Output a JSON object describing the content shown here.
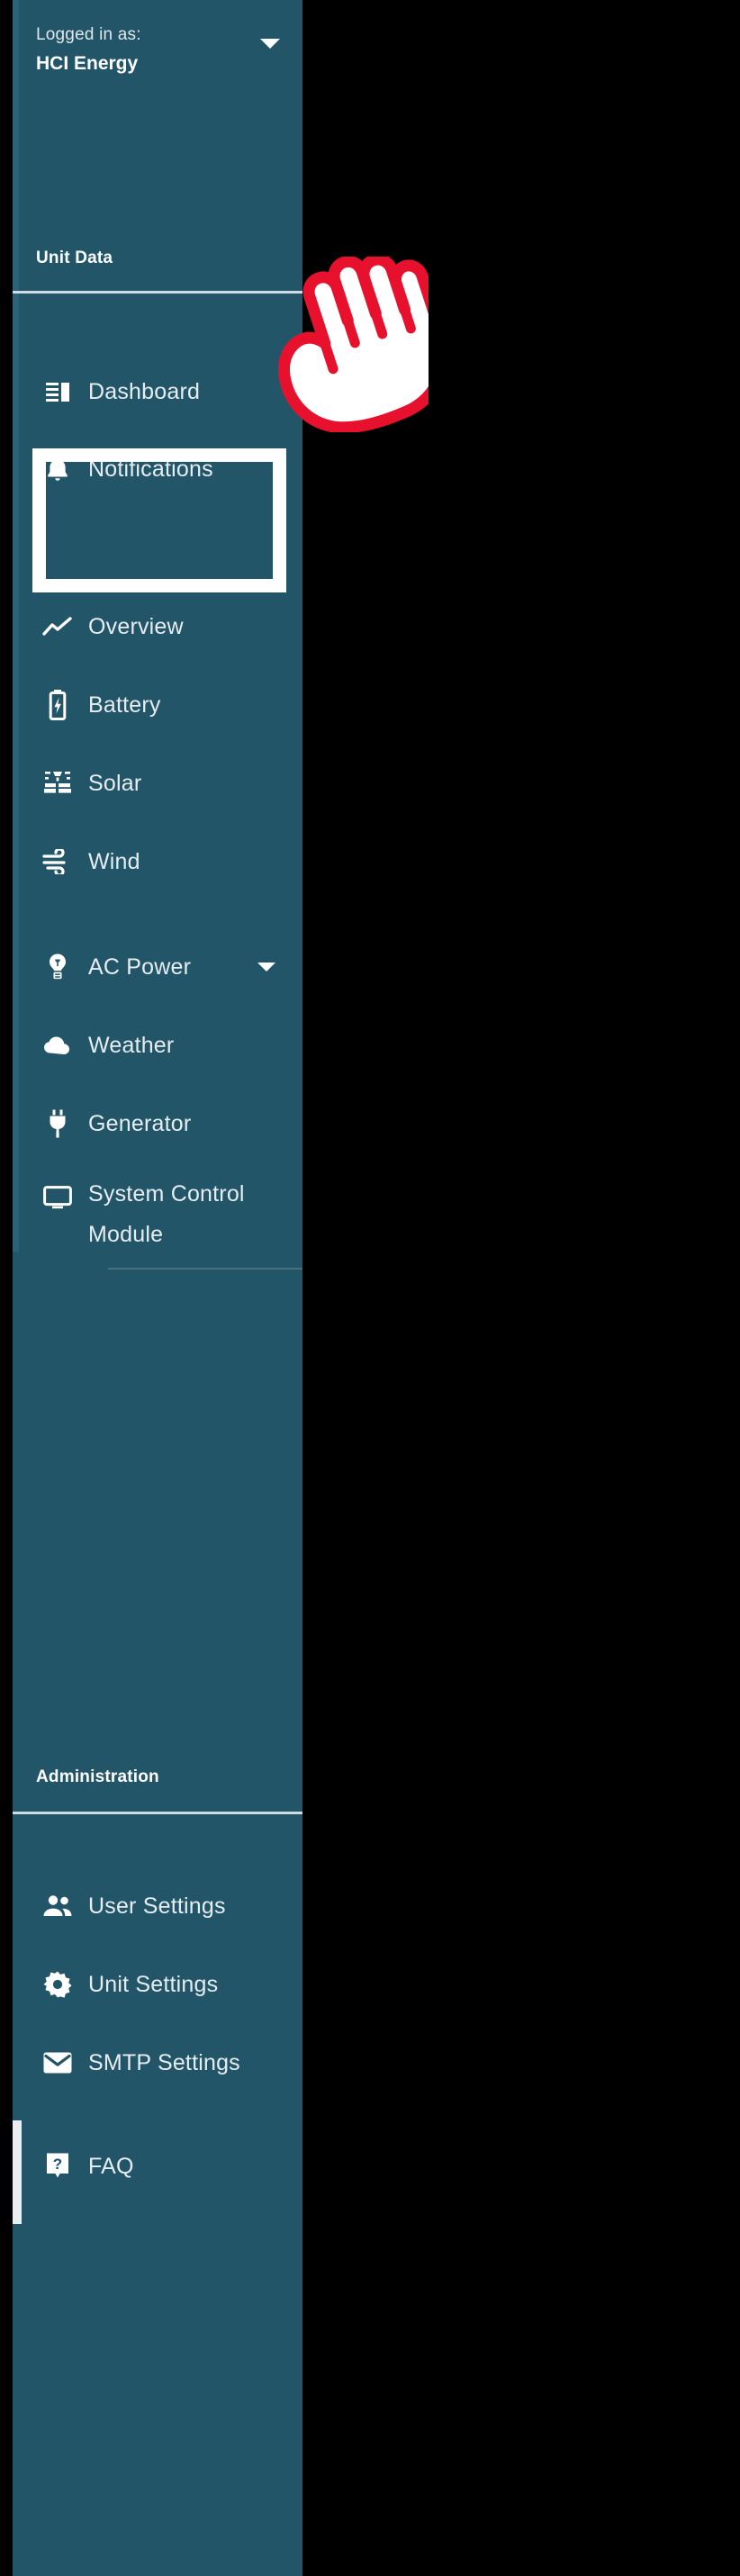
{
  "app": {
    "background_color": "#000000",
    "sidebar_color": "#235568",
    "text_color": "#e6edf1",
    "highlight_color": "#ffffff",
    "cursor_color": "#e8112d"
  },
  "account": {
    "label": "Logged in as:",
    "name": "HCI Energy",
    "caret_icon": "chevron-down-icon"
  },
  "sections": [
    {
      "title": "Unit Data"
    },
    {
      "title": "Administration"
    }
  ],
  "nav": {
    "unit_data": [
      {
        "label": "Dashboard",
        "icon": "dashboard-icon",
        "has_caret": false,
        "selected": false
      },
      {
        "label": "Notifications",
        "icon": "bell-icon",
        "has_caret": false,
        "selected": true
      },
      {
        "label": "Overview",
        "icon": "line-chart-icon",
        "has_caret": false,
        "selected": false
      },
      {
        "label": "Battery",
        "icon": "battery-icon",
        "has_caret": false,
        "selected": false
      },
      {
        "label": "Solar",
        "icon": "solar-panel-icon",
        "has_caret": false,
        "selected": false
      },
      {
        "label": "Wind",
        "icon": "wind-icon",
        "has_caret": false,
        "selected": false
      },
      {
        "label": "AC Power",
        "icon": "lightbulb-icon",
        "has_caret": true,
        "selected": false
      },
      {
        "label": "Weather",
        "icon": "cloud-icon",
        "has_caret": false,
        "selected": false
      },
      {
        "label": "Generator",
        "icon": "plug-icon",
        "has_caret": false,
        "selected": false
      },
      {
        "label": "System Control Module",
        "icon": "monitor-icon",
        "has_caret": false,
        "selected": false
      }
    ],
    "administration": [
      {
        "label": "User Settings",
        "icon": "users-icon",
        "has_caret": false,
        "selected": false
      },
      {
        "label": "Unit Settings",
        "icon": "gear-icon",
        "has_caret": false,
        "selected": false
      },
      {
        "label": "SMTP Settings",
        "icon": "envelope-icon",
        "has_caret": false,
        "selected": false
      },
      {
        "label": "FAQ",
        "icon": "question-icon",
        "has_caret": false,
        "selected": false
      }
    ]
  },
  "cursor": {
    "icon": "pointing-hand-cursor",
    "target": "Notifications"
  }
}
